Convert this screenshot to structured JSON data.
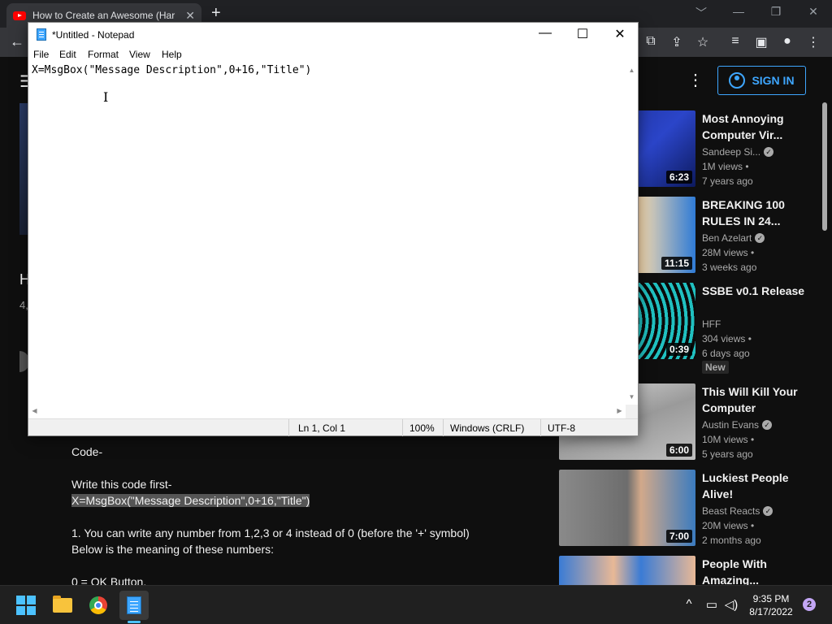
{
  "browser": {
    "tab_title": "How to Create an Awesome (Har",
    "tab_close": "✕",
    "new_tab": "+",
    "minimize": "﹀",
    "restore": "—",
    "maximize": "❐",
    "close": "✕"
  },
  "youtube": {
    "sign_in_label": "SIGN IN",
    "partial_title": "H",
    "partial_views": "4,",
    "description_lines": [
      "Code-",
      "",
      "Write this code first-",
      "X=MsgBox(\"Message Description\",0+16,\"Title\")",
      "",
      "1.  You can write any number from 1,2,3 or 4 instead of 0 (before the '+' symbol)",
      "Below is the meaning of these numbers:",
      "",
      "0 = OK Button,"
    ],
    "suggestions": [
      {
        "title": "Most Annoying Computer Vir...",
        "channel": "Sandeep Si...",
        "verified": true,
        "views": "1M views •",
        "age": "7 years ago",
        "duration": "6:23",
        "badge": ""
      },
      {
        "title": "BREAKING 100 RULES IN 24...",
        "channel": "Ben Azelart",
        "verified": true,
        "views": "28M views •",
        "age": "3 weeks ago",
        "duration": "11:15",
        "badge": ""
      },
      {
        "title": "SSBE v0.1 Release",
        "channel": "HFF",
        "verified": false,
        "views": "304 views •",
        "age": "6 days ago",
        "duration": "0:39",
        "badge": "New"
      },
      {
        "title": "This Will Kill Your Computer",
        "channel": "Austin Evans",
        "verified": true,
        "views": "10M views •",
        "age": "5 years ago",
        "duration": "6:00",
        "badge": ""
      },
      {
        "title": "Luckiest People Alive!",
        "channel": "Beast Reacts",
        "verified": true,
        "views": "20M views •",
        "age": "2 months ago",
        "duration": "7:00",
        "badge": ""
      },
      {
        "title": "People With Amazing...",
        "channel": "",
        "verified": false,
        "views": "",
        "age": "",
        "duration": "",
        "badge": ""
      }
    ]
  },
  "notepad": {
    "title": "*Untitled - Notepad",
    "menu": [
      "File",
      "Edit",
      "Format",
      "View",
      "Help"
    ],
    "content": "X=MsgBox(\"Message Description\",0+16,\"Title\")",
    "status": {
      "position": "Ln 1, Col 1",
      "zoom": "100%",
      "line_endings": "Windows (CRLF)",
      "encoding": "UTF-8"
    }
  },
  "taskbar": {
    "time": "9:35 PM",
    "date": "8/17/2022",
    "notifications": "2"
  }
}
